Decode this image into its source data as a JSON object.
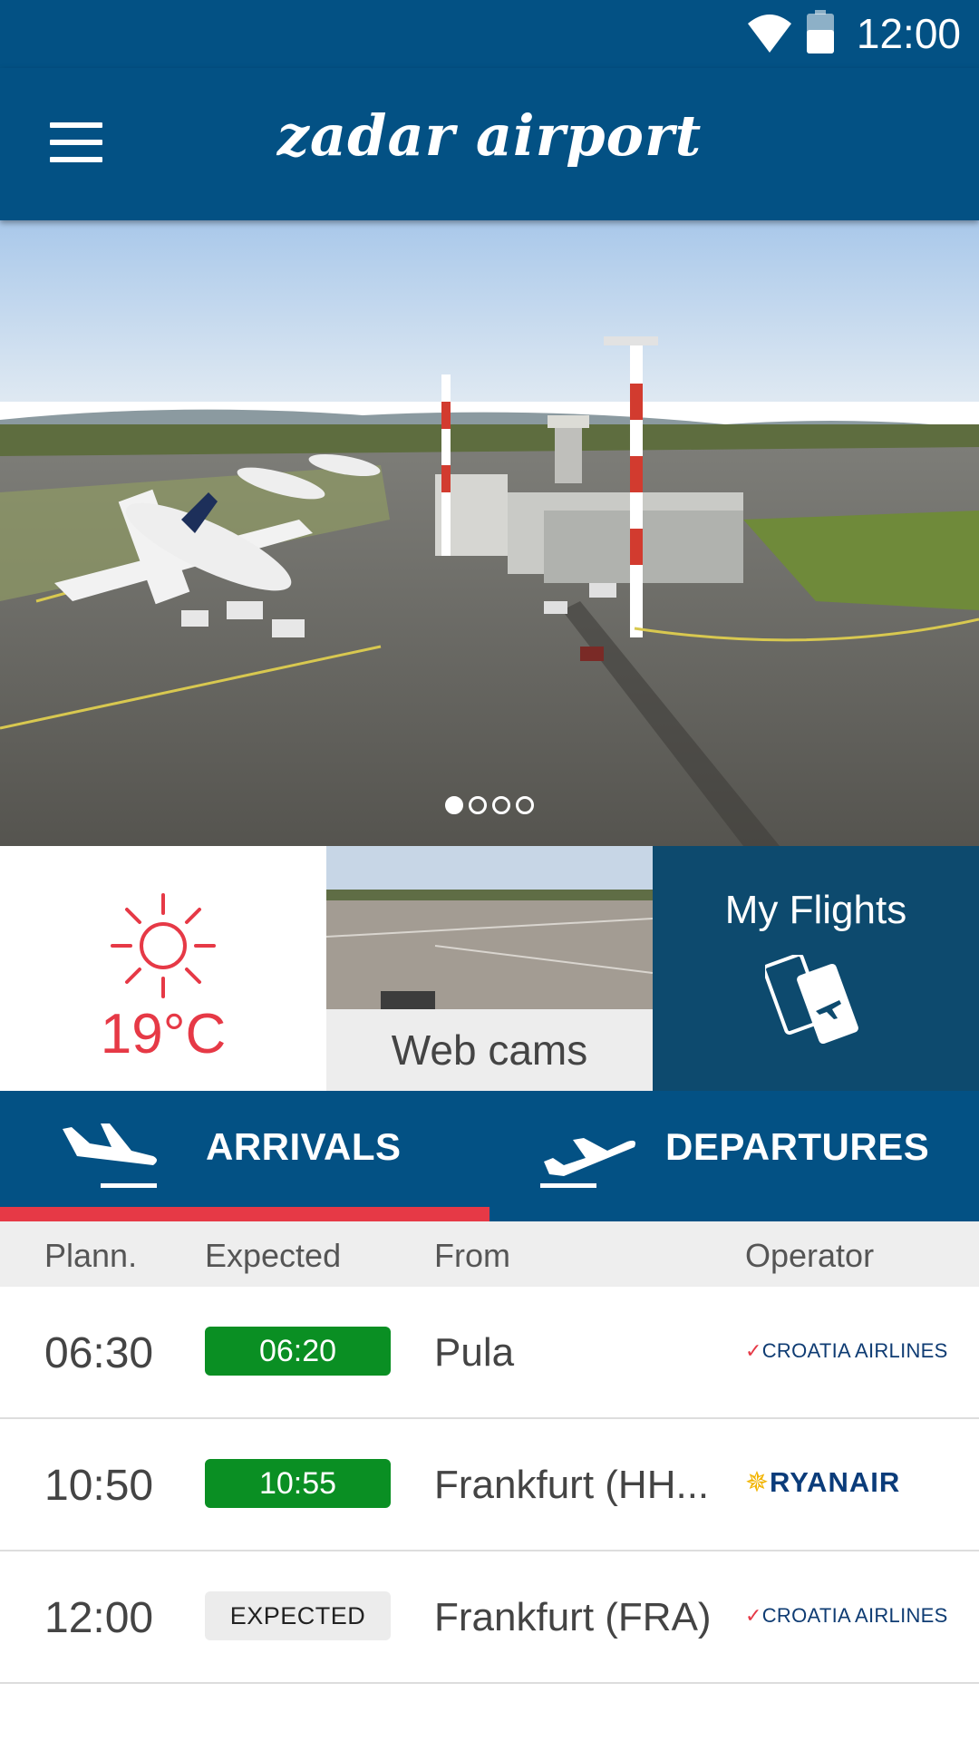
{
  "status_bar": {
    "time": "12:00"
  },
  "header": {
    "app_title": "zadar airport"
  },
  "carousel": {
    "slide_count": 4,
    "active_slide": 1
  },
  "tiles": {
    "weather": {
      "temperature": "19°C",
      "icon": "sun-icon",
      "color": "#e63946"
    },
    "webcams": {
      "label": "Web cams"
    },
    "my_flights": {
      "label": "My Flights",
      "icon": "boarding-pass-icon"
    }
  },
  "tabs": {
    "arrivals": {
      "label": "ARRIVALS",
      "icon": "plane-landing-icon",
      "active": true
    },
    "departures": {
      "label": "DEPARTURES",
      "icon": "plane-takeoff-icon",
      "active": false
    }
  },
  "table": {
    "headers": {
      "planned": "Plann.",
      "expected": "Expected",
      "from": "From",
      "operator": "Operator"
    },
    "rows": [
      {
        "planned": "06:30",
        "expected": "06:20",
        "expected_style": "green",
        "from": "Pula",
        "operator": "CROATIA AIRLINES"
      },
      {
        "planned": "10:50",
        "expected": "10:55",
        "expected_style": "green",
        "from": "Frankfurt (HH...",
        "operator": "RYANAIR"
      },
      {
        "planned": "12:00",
        "expected": "EXPECTED",
        "expected_style": "grey",
        "from": "Frankfurt (FRA)",
        "operator": "CROATIA AIRLINES"
      }
    ]
  },
  "colors": {
    "primary": "#035184",
    "tile_dark": "#0d4a6e",
    "accent": "#e63946",
    "on_time": "#0a8f23"
  }
}
